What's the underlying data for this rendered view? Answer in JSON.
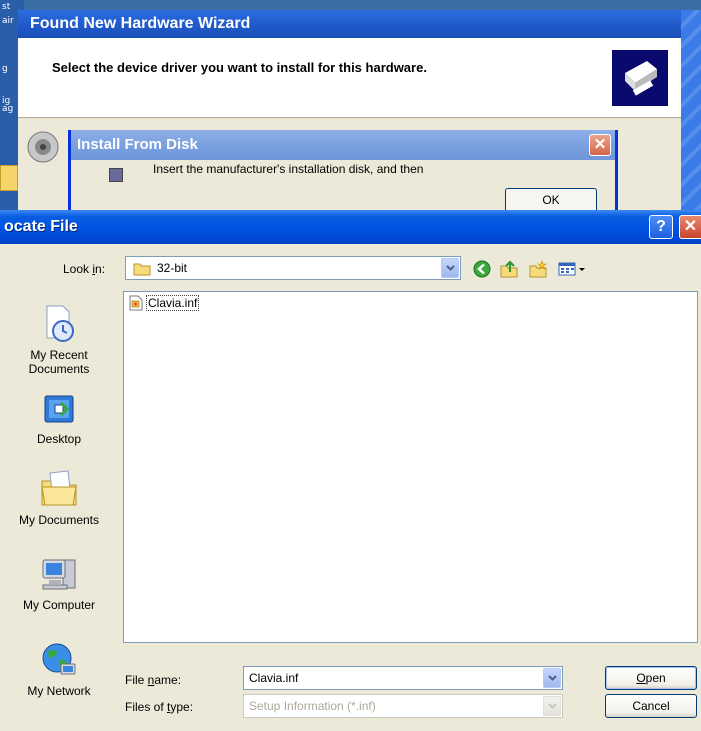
{
  "wizard": {
    "title": "Found New Hardware Wizard",
    "header_text": "Select the device driver you want to install for this hardware."
  },
  "desktop_fragments": [
    "st",
    "air",
    "g",
    "ig",
    "ag"
  ],
  "install_disk": {
    "title": "Install From Disk",
    "message": "Insert the manufacturer's installation disk, and then",
    "ok_label": "OK",
    "close_glyph": "✕"
  },
  "locate_file": {
    "title": "ocate File",
    "help_glyph": "?",
    "close_glyph": "✕",
    "look_in": {
      "label_pre": "Look ",
      "label_key": "i",
      "label_post": "n:",
      "value": "32-bit"
    },
    "places": [
      {
        "line1": "My Recent",
        "line2": "Documents"
      },
      {
        "line1": "Desktop",
        "line2": ""
      },
      {
        "line1": "My Documents",
        "line2": ""
      },
      {
        "line1": "My Computer",
        "line2": ""
      },
      {
        "line1": "My Network",
        "line2": ""
      }
    ],
    "files": [
      "Clavia.inf"
    ],
    "file_name": {
      "label_pre": "File ",
      "label_key": "n",
      "label_post": "ame:",
      "value": "Clavia.inf"
    },
    "file_type": {
      "label_pre": "Files of ",
      "label_key": "t",
      "label_post": "ype:",
      "value": "Setup Information (*.inf)"
    },
    "open_button": {
      "key": "O",
      "rest": "pen"
    },
    "cancel_button": "Cancel"
  },
  "colors": {
    "xp_blue": "#0054e3",
    "dialog_face": "#ece9d8",
    "border": "#7f9db9"
  }
}
